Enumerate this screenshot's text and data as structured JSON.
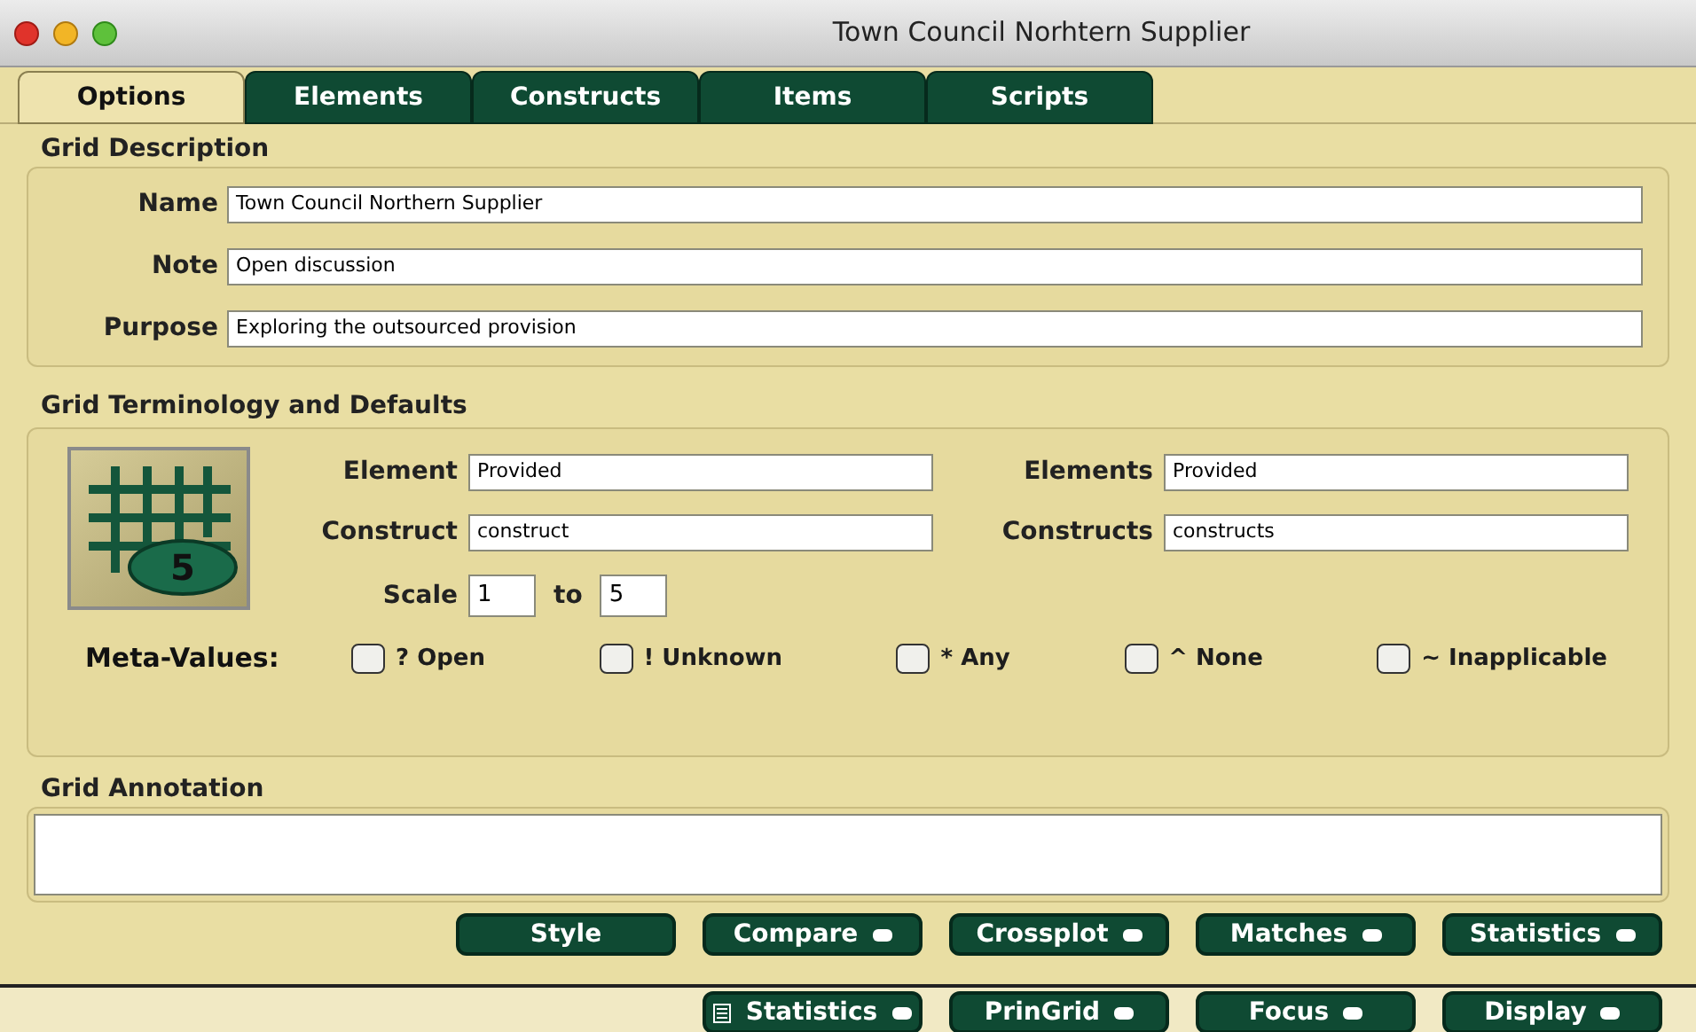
{
  "window": {
    "title": "Town Council Norhtern Supplier"
  },
  "tabs": [
    {
      "label": "Options",
      "selected": true
    },
    {
      "label": "Elements",
      "selected": false
    },
    {
      "label": "Constructs",
      "selected": false
    },
    {
      "label": "Items",
      "selected": false
    },
    {
      "label": "Scripts",
      "selected": false
    }
  ],
  "grid_description": {
    "heading": "Grid Description",
    "fields": [
      {
        "label": "Name",
        "value": "Town Council Northern Supplier"
      },
      {
        "label": "Note",
        "value": "Open discussion"
      },
      {
        "label": "Purpose",
        "value": "Exploring the outsourced provision"
      }
    ]
  },
  "terminology": {
    "heading": "Grid Terminology and Defaults",
    "badge": "5",
    "fields": [
      {
        "label": "Element",
        "value": "Provided"
      },
      {
        "label": "Elements",
        "value": "Provided"
      },
      {
        "label": "Construct",
        "value": "construct"
      },
      {
        "label": "Constructs",
        "value": "constructs"
      }
    ],
    "scale": {
      "label": "Scale",
      "from": "1",
      "to_label": "to",
      "to": "5"
    },
    "meta_label": "Meta-Values:",
    "meta_values": [
      {
        "label": "? Open",
        "checked": false
      },
      {
        "label": "! Unknown",
        "checked": false
      },
      {
        "label": "* Any",
        "checked": false
      },
      {
        "label": "^ None",
        "checked": false
      },
      {
        "label": "~ Inapplicable",
        "checked": false
      }
    ]
  },
  "annotation": {
    "heading": "Grid Annotation"
  },
  "buttons": [
    {
      "label": "Style",
      "has_menu": false
    },
    {
      "label": "Compare",
      "has_menu": true
    },
    {
      "label": "Crossplot",
      "has_menu": true
    },
    {
      "label": "Matches",
      "has_menu": true
    },
    {
      "label": "Statistics",
      "has_menu": true
    }
  ],
  "buttons_lower": [
    {
      "label": "Statistics",
      "has_menu": true,
      "has_icon": true
    },
    {
      "label": "PrinGrid",
      "has_menu": true,
      "has_icon": false
    },
    {
      "label": "Focus",
      "has_menu": true,
      "has_icon": false
    },
    {
      "label": "Display",
      "has_menu": true,
      "has_icon": false
    }
  ]
}
